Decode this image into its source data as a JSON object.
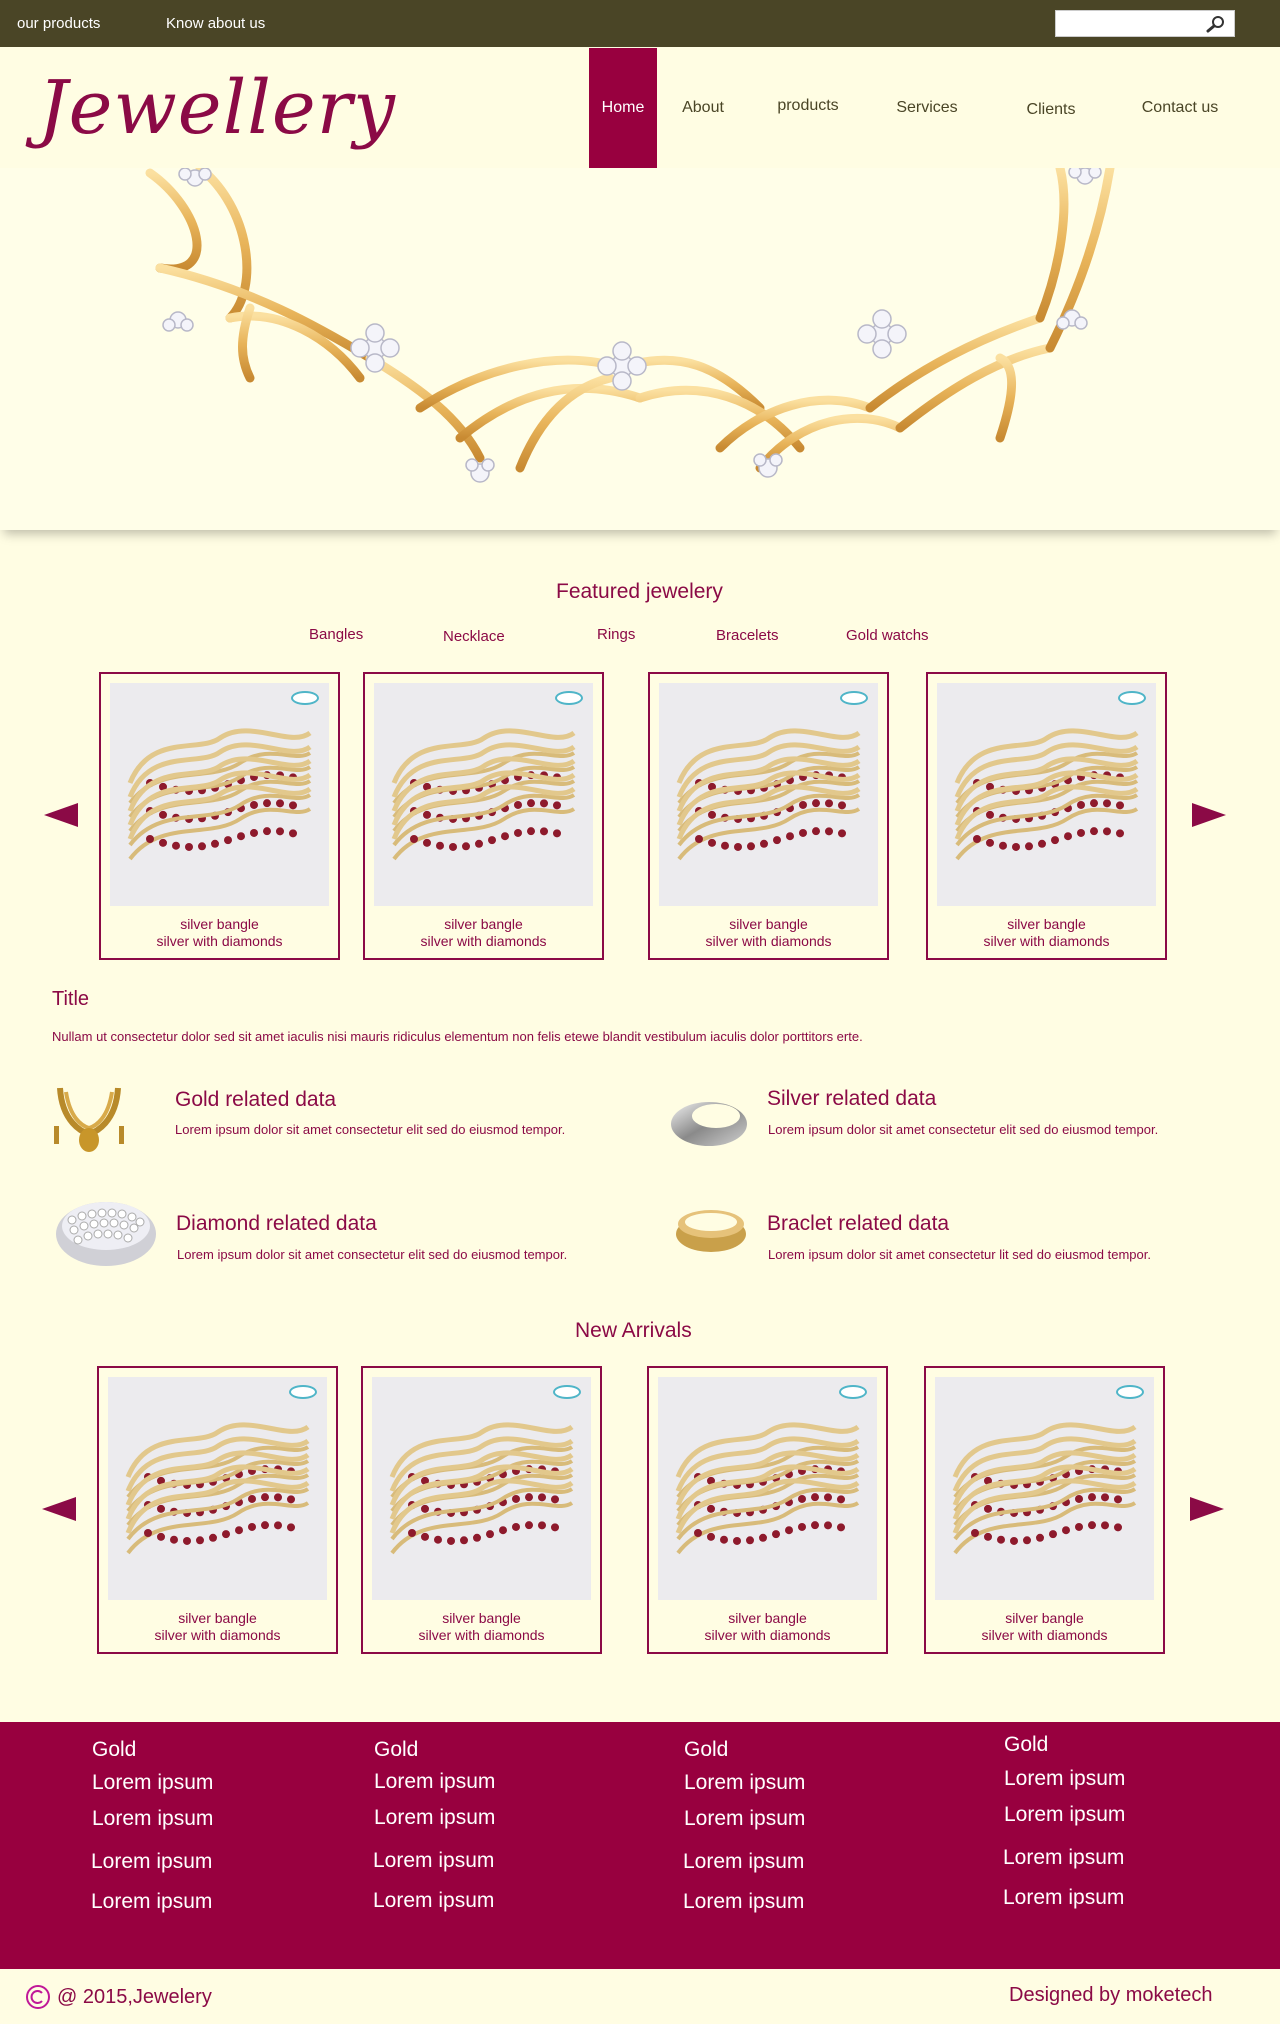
{
  "topbar": {
    "links": [
      "our products",
      "Know about us"
    ],
    "search": {
      "value": "",
      "placeholder": ""
    }
  },
  "logo": "Jewellery",
  "nav": [
    "Home",
    "About",
    "products",
    "Services",
    "Clients",
    "Contact us"
  ],
  "featured": {
    "title": "Featured jewelery",
    "categories": [
      "Bangles",
      "Necklace",
      "Rings",
      "Bracelets",
      "Gold watchs"
    ],
    "cards": [
      {
        "line1": "silver bangle",
        "line2": "silver with diamonds"
      },
      {
        "line1": "silver bangle",
        "line2": "silver with diamonds"
      },
      {
        "line1": "silver bangle",
        "line2": "silver with diamonds"
      },
      {
        "line1": "silver bangle",
        "line2": "silver with diamonds"
      }
    ]
  },
  "intro": {
    "title": "Title",
    "text": "Nullam ut consectetur dolor sed sit amet iaculis nisi mauris ridiculus elementum non felis etewe blandit vestibulum iaculis dolor porttitors erte."
  },
  "features": [
    {
      "title": "Gold related data",
      "desc": "Lorem ipsum dolor sit amet consectetur  elit sed do eiusmod tempor."
    },
    {
      "title": "Silver related data",
      "desc": "Lorem ipsum dolor sit amet consectetur  elit sed do eiusmod tempor."
    },
    {
      "title": "Diamond related data",
      "desc": "Lorem ipsum dolor sit amet consectetur  elit sed do eiusmod tempor."
    },
    {
      "title": "Braclet related data",
      "desc": "Lorem ipsum dolor sit amet consectetur  lit sed do eiusmod tempor."
    }
  ],
  "arrivals": {
    "title": "New Arrivals",
    "cards": [
      {
        "line1": "silver bangle",
        "line2": "silver with diamonds"
      },
      {
        "line1": "silver bangle",
        "line2": "silver with diamonds"
      },
      {
        "line1": "silver bangle",
        "line2": "silver with diamonds"
      },
      {
        "line1": "silver bangle",
        "line2": "silver with diamonds"
      }
    ]
  },
  "footer": {
    "columns": [
      {
        "head": "Gold",
        "items": [
          "Lorem ipsum",
          "Lorem ipsum",
          "Lorem ipsum",
          "Lorem ipsum"
        ]
      },
      {
        "head": "Gold",
        "items": [
          "Lorem ipsum",
          "Lorem ipsum",
          "Lorem ipsum",
          "Lorem ipsum"
        ]
      },
      {
        "head": "Gold",
        "items": [
          "Lorem ipsum",
          "Lorem ipsum",
          "Lorem ipsum",
          "Lorem ipsum"
        ]
      },
      {
        "head": "Gold",
        "items": [
          "Lorem ipsum",
          "Lorem ipsum",
          "Lorem ipsum",
          "Lorem ipsum"
        ]
      }
    ]
  },
  "copyright": "@ 2015,Jewelery",
  "designed_by": "Designed by moketech",
  "colors": {
    "brand": "#98003f",
    "topbar": "#4a4526",
    "background": "#fffde3"
  }
}
